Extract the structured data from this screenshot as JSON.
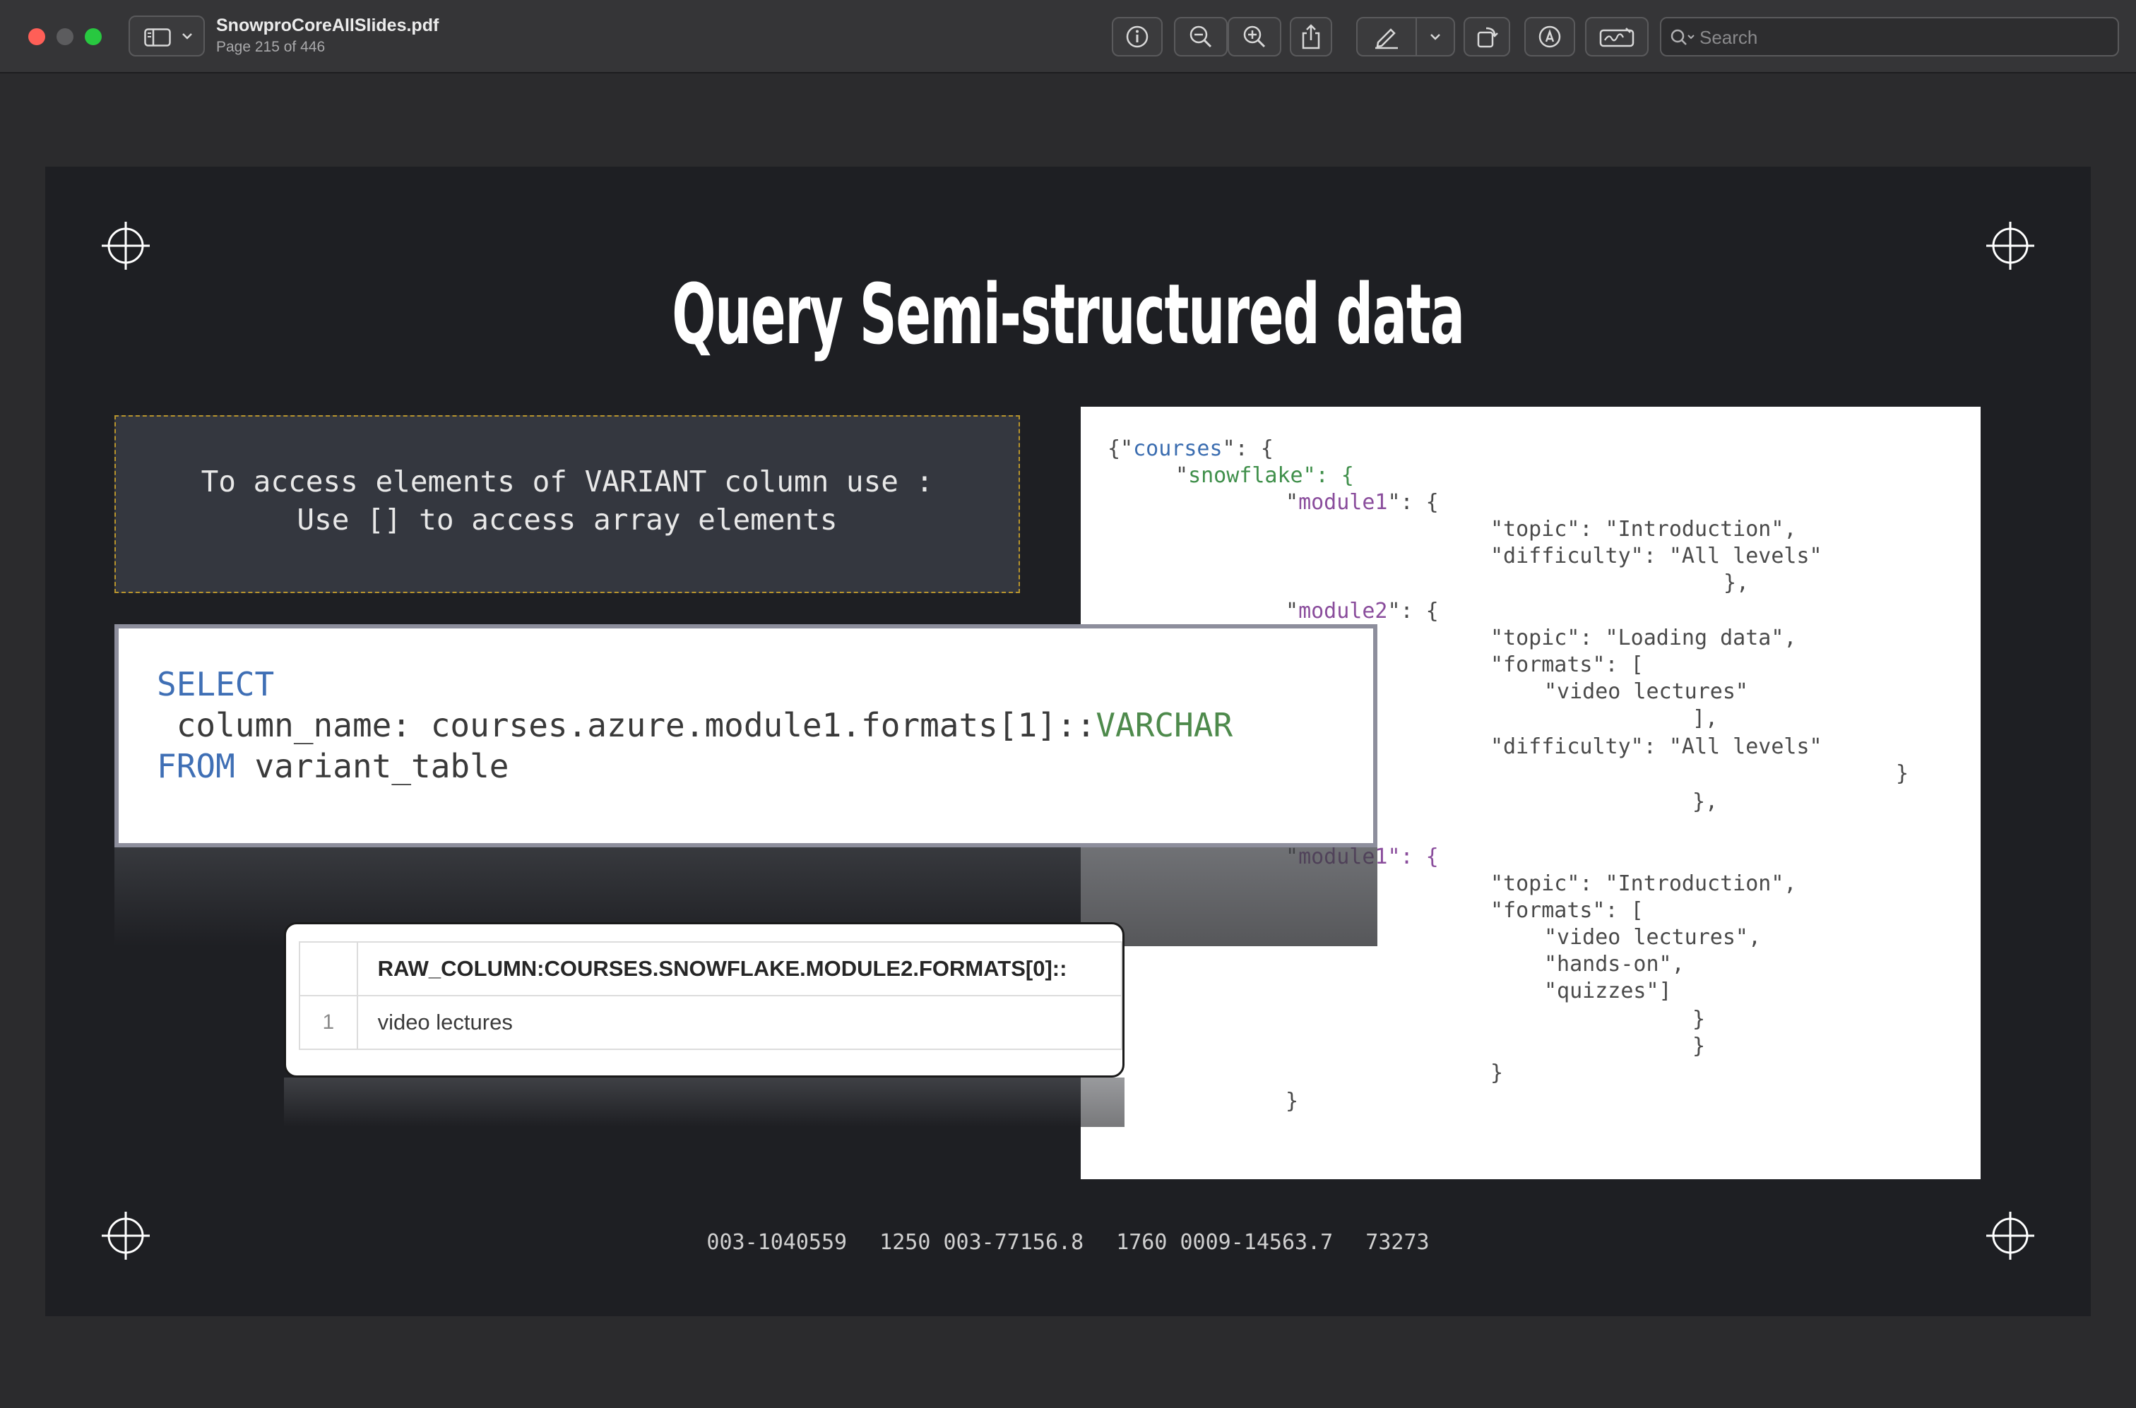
{
  "window": {
    "doc_title": "SnowproCoreAllSlides.pdf",
    "page_info": "Page 215 of 446",
    "search_placeholder": "Search"
  },
  "toolbar": {
    "icons": [
      "info-icon",
      "zoom-out-icon",
      "zoom-in-icon",
      "share-icon",
      "markup-pen-icon",
      "chevron-down-icon",
      "rotate-icon",
      "highlight-circle-icon",
      "signature-icon"
    ]
  },
  "slide": {
    "title": "Query Semi-structured data",
    "info_line1": "To access elements of VARIANT column use :",
    "info_line2": "Use [] to access array elements",
    "sql": {
      "kw_select": "SELECT",
      "line2": " column_name: courses.azure.module1.formats[1]::",
      "type_varchar": "VARCHAR",
      "kw_from": "FROM",
      "line3": " variant_table"
    },
    "result": {
      "column_header": "RAW_COLUMN:COURSES.SNOWFLAKE.MODULE2.FORMATS[0]::",
      "row_number": "1",
      "value": "video lectures"
    },
    "footer": [
      "003-1040559",
      "1250 003-77156.8",
      "1760 0009-14563.7",
      "73273"
    ]
  },
  "json_code": {
    "l1a": "{\"",
    "l1b": "courses",
    "l1c": "\": {",
    "l2a": "\"",
    "l2b": "snowflake",
    "l2c": "\": {",
    "l3a": "\"",
    "l3b": "module1",
    "l3c": "\": {",
    "l4": "\"topic\": \"Introduction\",",
    "l5": "\"difficulty\": \"All levels\"",
    "l6": "},",
    "l7a": "\"",
    "l7b": "module2",
    "l7c": "\": {",
    "l8": "\"topic\": \"Loading data\",",
    "l9": "\"formats\": [",
    "l10": "\"video lectures\"",
    "l11": "],",
    "l12": "\"difficulty\": \"All levels\"",
    "l13": "}",
    "l14": "},",
    "l15a": "\"",
    "l15b": "module1",
    "l15c": "\": {",
    "l16": "\"topic\": \"Introduction\",",
    "l17": "\"formats\": [",
    "l18": "\"video lectures\",",
    "l19": "\"hands-on\",",
    "l20": "\"quizzes\"]",
    "l21": "}",
    "l22": "}",
    "l23": "}",
    "l24": "}"
  },
  "colors": {
    "close": "#ff5f57",
    "maximize": "#28c840",
    "sql_keyword": "#3f6fb5",
    "sql_type": "#4e8a4c",
    "info_border": "#b8942c"
  }
}
